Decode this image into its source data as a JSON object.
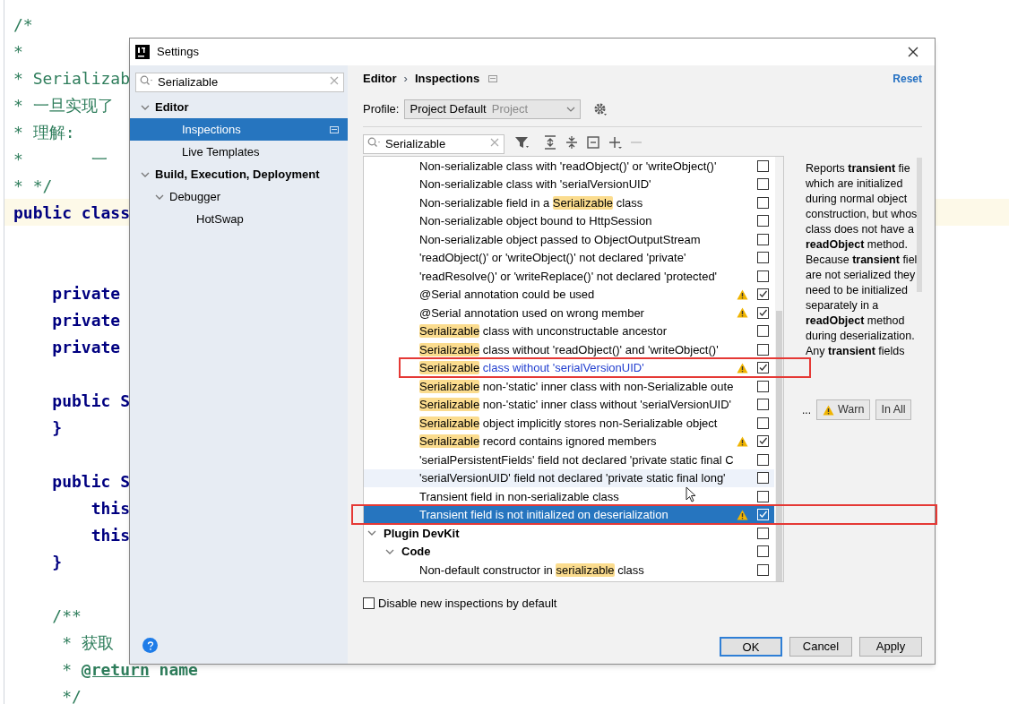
{
  "editor": {
    "lines": [
      {
        "kind": "comment",
        "text": "/*"
      },
      {
        "kind": "comment",
        "text": "*"
      },
      {
        "kind": "comment",
        "text": "* Serializab"
      },
      {
        "kind": "comment",
        "text": "* 一旦实现了"
      },
      {
        "kind": "comment",
        "text": "* 理解:"
      },
      {
        "kind": "comment",
        "text": "*       一"
      },
      {
        "kind": "comment",
        "text": "* */"
      },
      {
        "kind": "code",
        "text": "public class",
        "current": true
      },
      {
        "kind": "blank"
      },
      {
        "kind": "blank"
      },
      {
        "kind": "code",
        "text": "    private"
      },
      {
        "kind": "code",
        "text": "    private"
      },
      {
        "kind": "code",
        "text": "    private"
      },
      {
        "kind": "blank"
      },
      {
        "kind": "code",
        "text": "    public S"
      },
      {
        "kind": "code",
        "text": "    }"
      },
      {
        "kind": "blank"
      },
      {
        "kind": "code",
        "text": "    public S"
      },
      {
        "kind": "code",
        "text": "        this"
      },
      {
        "kind": "code",
        "text": "        this"
      },
      {
        "kind": "code",
        "text": "    }"
      },
      {
        "kind": "blank"
      },
      {
        "kind": "comment",
        "text": "    /**"
      },
      {
        "kind": "comment",
        "text": "     * 获取"
      },
      {
        "kind": "doctag",
        "text": "     * ",
        "tag": "@return",
        "rest": " name"
      },
      {
        "kind": "comment",
        "text": "     */"
      }
    ]
  },
  "dialog": {
    "title": "Settings",
    "search": {
      "value": "Serializable"
    },
    "nav": [
      {
        "label": "Editor",
        "expanded": true,
        "selected": false,
        "children": [
          {
            "label": "Inspections",
            "selected": true
          },
          {
            "label": "Live Templates",
            "selected": false
          }
        ]
      },
      {
        "label": "Build, Execution, Deployment",
        "expanded": true,
        "selected": false,
        "children": [
          {
            "label": "Debugger",
            "expanded": true,
            "selected": false,
            "children": [
              {
                "label": "HotSwap",
                "selected": false
              }
            ]
          }
        ]
      }
    ],
    "breadcrumb": [
      "Editor",
      "›",
      "Inspections"
    ],
    "reset": "Reset",
    "profile": {
      "label": "Profile:",
      "value": "Project Default",
      "scope": "Project"
    },
    "filter": {
      "value": "Serializable"
    },
    "inspections": [
      {
        "parts": [
          {
            "text": "Non-serializable class with 'readObject()' or 'writeObject()'"
          }
        ],
        "checked": false,
        "warning": false
      },
      {
        "parts": [
          {
            "text": "Non-serializable class with 'serialVersionUID'"
          }
        ],
        "checked": false,
        "warning": false
      },
      {
        "parts": [
          {
            "text": "Non-serializable field in a "
          },
          {
            "text": "Serializable",
            "match": true
          },
          {
            "text": " class"
          }
        ],
        "checked": false,
        "warning": false
      },
      {
        "parts": [
          {
            "text": "Non-serializable object bound to HttpSession"
          }
        ],
        "checked": false,
        "warning": false
      },
      {
        "parts": [
          {
            "text": "Non-serializable object passed to ObjectOutputStream"
          }
        ],
        "checked": false,
        "warning": false
      },
      {
        "parts": [
          {
            "text": "'readObject()' or 'writeObject()' not declared 'private'"
          }
        ],
        "checked": false,
        "warning": false
      },
      {
        "parts": [
          {
            "text": "'readResolve()' or 'writeReplace()' not declared 'protected'"
          }
        ],
        "checked": false,
        "warning": false
      },
      {
        "parts": [
          {
            "text": "@Serial annotation could be used"
          }
        ],
        "checked": true,
        "warning": true
      },
      {
        "parts": [
          {
            "text": "@Serial annotation used on wrong member"
          }
        ],
        "checked": true,
        "warning": true
      },
      {
        "parts": [
          {
            "text": "Serializable",
            "match": true
          },
          {
            "text": " class with unconstructable ancestor"
          }
        ],
        "checked": false,
        "warning": false
      },
      {
        "parts": [
          {
            "text": "Serializable",
            "match": true
          },
          {
            "text": " class without 'readObject()' and 'writeObject()'"
          }
        ],
        "checked": false,
        "warning": false
      },
      {
        "parts": [
          {
            "text": "Serializable",
            "match": true
          },
          {
            "text": " class without 'serialVersionUID'"
          }
        ],
        "checked": true,
        "warning": true,
        "modified": true,
        "boxed": true
      },
      {
        "parts": [
          {
            "text": "Serializable",
            "match": true
          },
          {
            "text": " non-'static' inner class with non-Serializable oute"
          }
        ],
        "checked": false,
        "warning": false
      },
      {
        "parts": [
          {
            "text": "Serializable",
            "match": true
          },
          {
            "text": " non-'static' inner class without 'serialVersionUID'"
          }
        ],
        "checked": false,
        "warning": false
      },
      {
        "parts": [
          {
            "text": "Serializable",
            "match": true
          },
          {
            "text": " object implicitly stores non-Serializable object"
          }
        ],
        "checked": false,
        "warning": false
      },
      {
        "parts": [
          {
            "text": "Serializable",
            "match": true
          },
          {
            "text": " record contains ignored members"
          }
        ],
        "checked": true,
        "warning": true
      },
      {
        "parts": [
          {
            "text": "'serialPersistentFields' field not declared 'private static final C"
          }
        ],
        "checked": false,
        "warning": false
      },
      {
        "parts": [
          {
            "text": "'serialVersionUID' field not declared 'private static final long'"
          }
        ],
        "checked": false,
        "warning": false,
        "hovered": true
      },
      {
        "parts": [
          {
            "text": "Transient field in non-serializable class"
          }
        ],
        "checked": false,
        "warning": false
      },
      {
        "parts": [
          {
            "text": "Transient field is not initialized on deserialization"
          }
        ],
        "checked": true,
        "warning": true,
        "selected": true,
        "boxed": true
      },
      {
        "label": "Plugin DevKit",
        "expanded": true,
        "checked": false,
        "children": [
          {
            "label": "Code",
            "expanded": true,
            "checked": false,
            "children": [
              {
                "parts": [
                  {
                    "text": "Non-default constructor in "
                  },
                  {
                    "text": "serializable",
                    "match": true
                  },
                  {
                    "text": " class"
                  }
                ],
                "checked": false,
                "warning": false
              }
            ]
          }
        ]
      }
    ],
    "description": [
      "Reports **transient** fie",
      "which are initialized",
      "during normal object",
      "construction, but whos",
      "class does not have a",
      "**readObject** method.",
      "Because **transient** fiel",
      "are not serialized they",
      "need to be initialized",
      "separately in a",
      "**readObject** method",
      "during deserialization.",
      "Any **transient** fields"
    ],
    "severity": {
      "more": "...",
      "value": "Warn",
      "scope": "In All"
    },
    "disable_new": {
      "label": "Disable new inspections by default",
      "checked": false
    },
    "buttons": [
      {
        "label": "OK",
        "default": true
      },
      {
        "label": "Cancel",
        "default": false
      },
      {
        "label": "Apply",
        "default": false
      }
    ]
  }
}
